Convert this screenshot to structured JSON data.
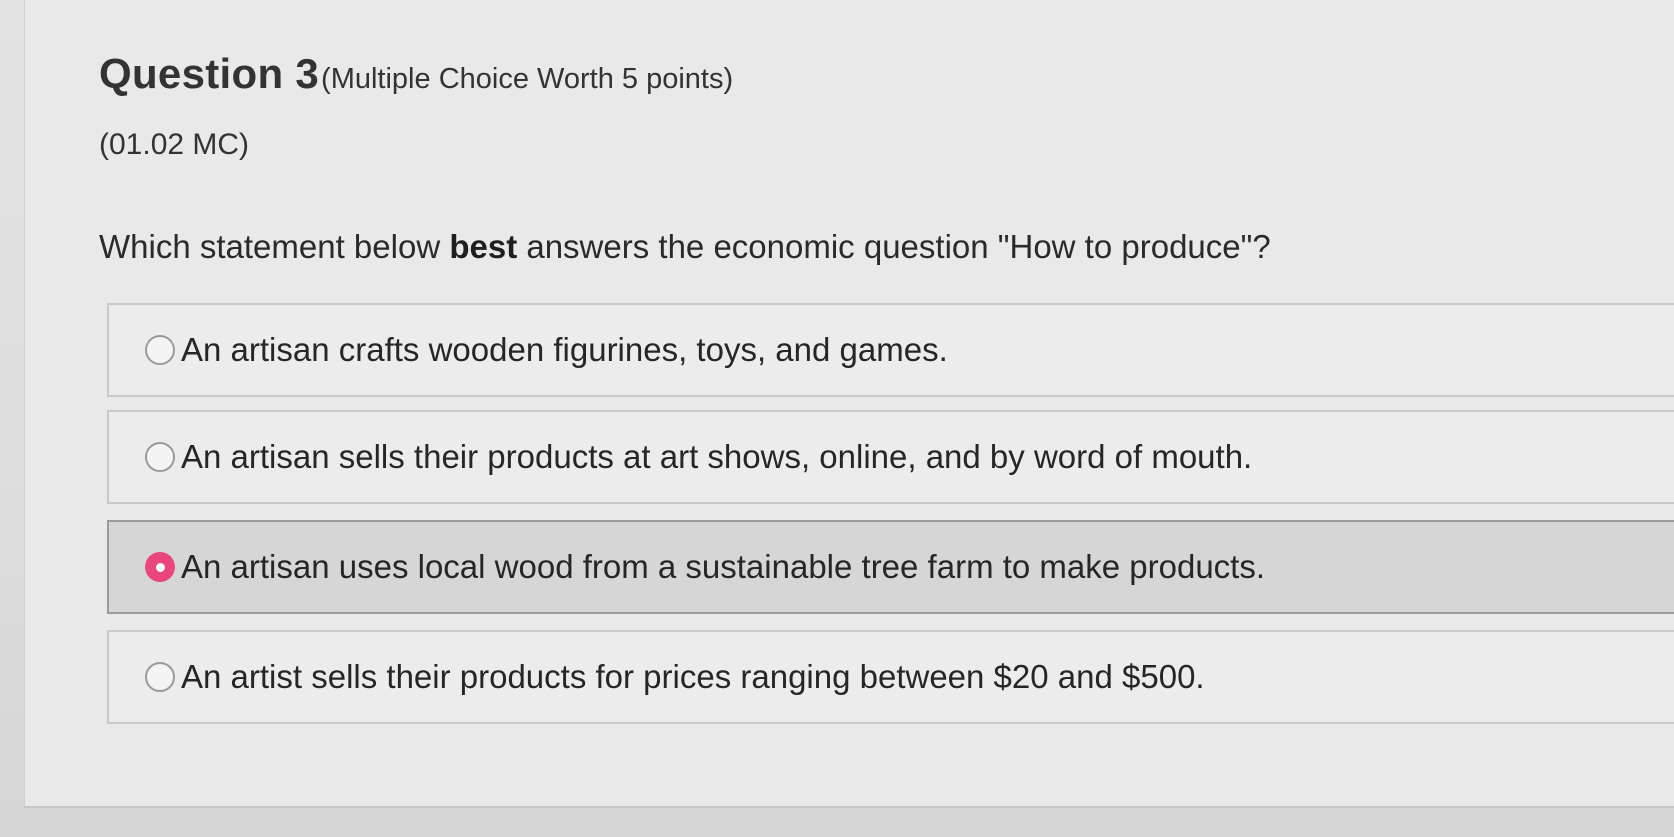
{
  "question": {
    "title": "Question 3",
    "meta": "(Multiple Choice Worth 5 points)",
    "code": "(01.02 MC)",
    "text_before": "Which statement below ",
    "text_bold": "best",
    "text_after": " answers the economic question \"How to produce\"?"
  },
  "options": [
    {
      "label": "An artisan crafts wooden figurines, toys, and games.",
      "selected": false
    },
    {
      "label": "An artisan sells their products at art shows, online, and by word of mouth.",
      "selected": false
    },
    {
      "label": "An artisan uses local wood from a sustainable tree farm to make products.",
      "selected": true
    },
    {
      "label": "An artist sells their products for prices ranging between $20 and $500.",
      "selected": false
    }
  ],
  "colors": {
    "selected_radio": "#e8467c",
    "selected_option_bg": "#d6d6d6"
  }
}
